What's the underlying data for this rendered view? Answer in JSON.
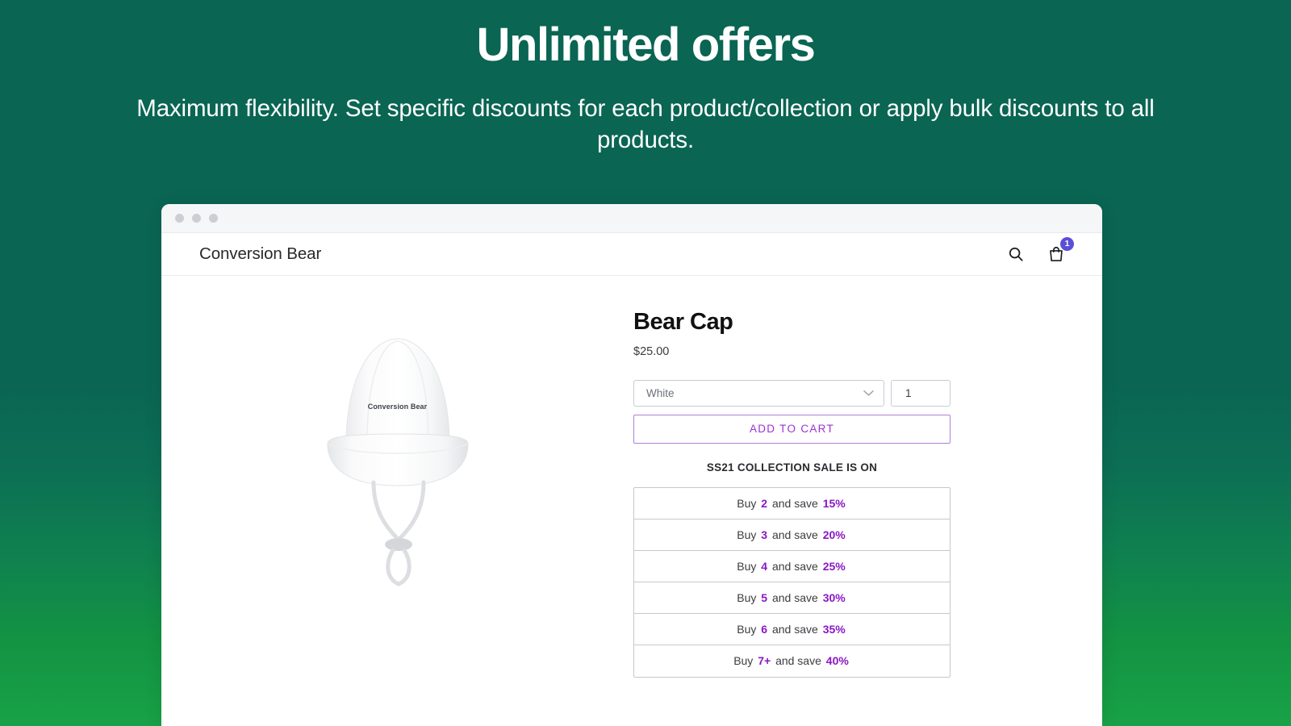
{
  "hero": {
    "title": "Unlimited offers",
    "subtitle": "Maximum flexibility. Set specific discounts for each product/collection or apply bulk discounts to all products."
  },
  "colors": {
    "background_top": "#0a6553",
    "background_bottom": "#18a247",
    "accent_purple": "#8a17c4",
    "atc_purple": "#9b33cf",
    "badge_purple": "#5b4fd6"
  },
  "browser": {
    "traffic_lights": [
      "window-close-dot",
      "window-minimize-dot",
      "window-maximize-dot"
    ]
  },
  "store": {
    "logo": "Conversion Bear",
    "icons": {
      "search": "search-icon",
      "cart": "shopping-bag-icon",
      "cart_count": "1"
    }
  },
  "product": {
    "image_label": "Conversion Bear",
    "title": "Bear Cap",
    "price": "$25.00",
    "variant": {
      "selected": "White",
      "options": [
        "White"
      ]
    },
    "quantity": "1",
    "add_to_cart_label": "ADD TO CART",
    "sale_heading": "SS21 COLLECTION SALE IS ON",
    "tiers": [
      {
        "prefix": "Buy",
        "qty": "2",
        "middle": "and save",
        "discount": "15%"
      },
      {
        "prefix": "Buy",
        "qty": "3",
        "middle": "and save",
        "discount": "20%"
      },
      {
        "prefix": "Buy",
        "qty": "4",
        "middle": "and save",
        "discount": "25%"
      },
      {
        "prefix": "Buy",
        "qty": "5",
        "middle": "and save",
        "discount": "30%"
      },
      {
        "prefix": "Buy",
        "qty": "6",
        "middle": "and save",
        "discount": "35%"
      },
      {
        "prefix": "Buy",
        "qty": "7+",
        "middle": "and save",
        "discount": "40%"
      }
    ]
  }
}
